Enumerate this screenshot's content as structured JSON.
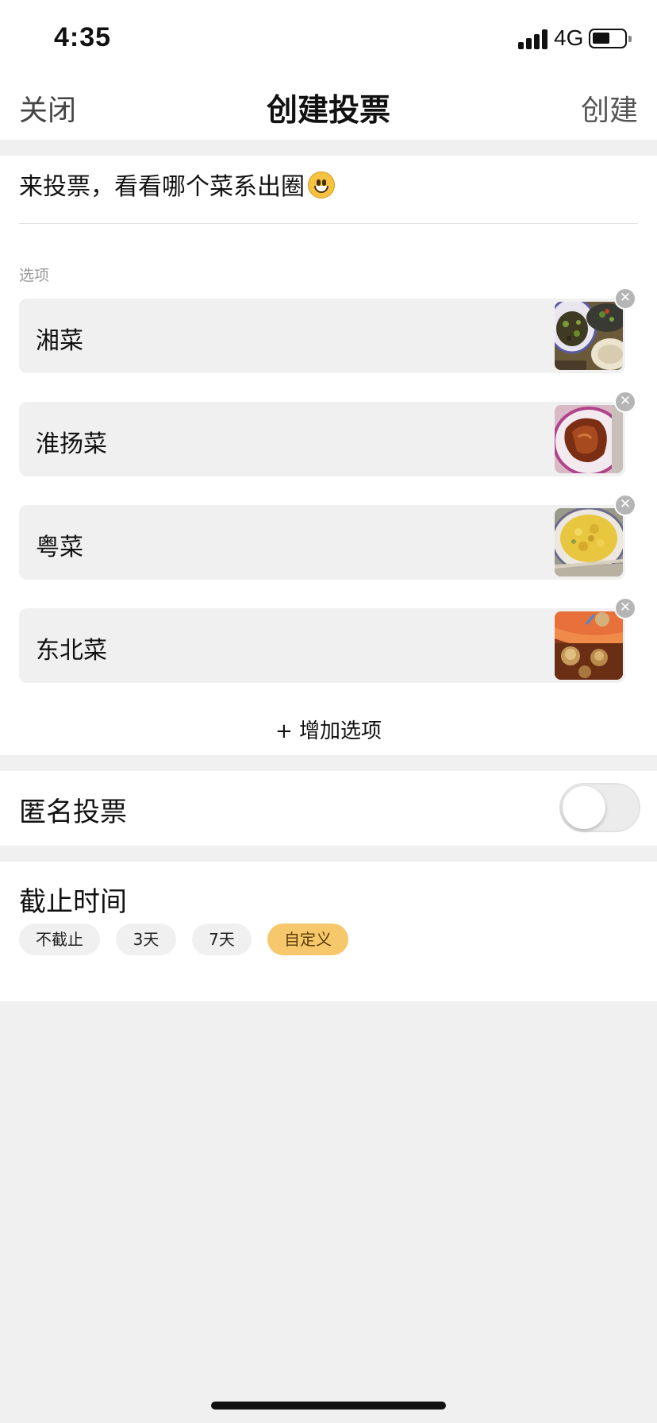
{
  "status_bar": {
    "time": "4:35",
    "network": "4G"
  },
  "nav": {
    "close_label": "关闭",
    "title": "创建投票",
    "create_label": "创建"
  },
  "question": "来投票，看看哪个菜系出圈",
  "options_section_label": "选项",
  "options": [
    {
      "label": "湘菜",
      "photo": "hunan-dishes-photo"
    },
    {
      "label": "淮扬菜",
      "photo": "braised-duck-photo"
    },
    {
      "label": "粤菜",
      "photo": "fried-rice-photo"
    },
    {
      "label": "东北菜",
      "photo": "braised-pork-photo"
    }
  ],
  "remove_glyph": "✕",
  "add_option_label": "+ 增加选项",
  "anonymous": {
    "label": "匿名投票",
    "enabled": false
  },
  "deadline": {
    "label": "截止时间",
    "chips": [
      "不截止",
      "3天",
      "7天",
      "自定义"
    ],
    "selected": "自定义",
    "accent_color": "#f7c76b"
  }
}
